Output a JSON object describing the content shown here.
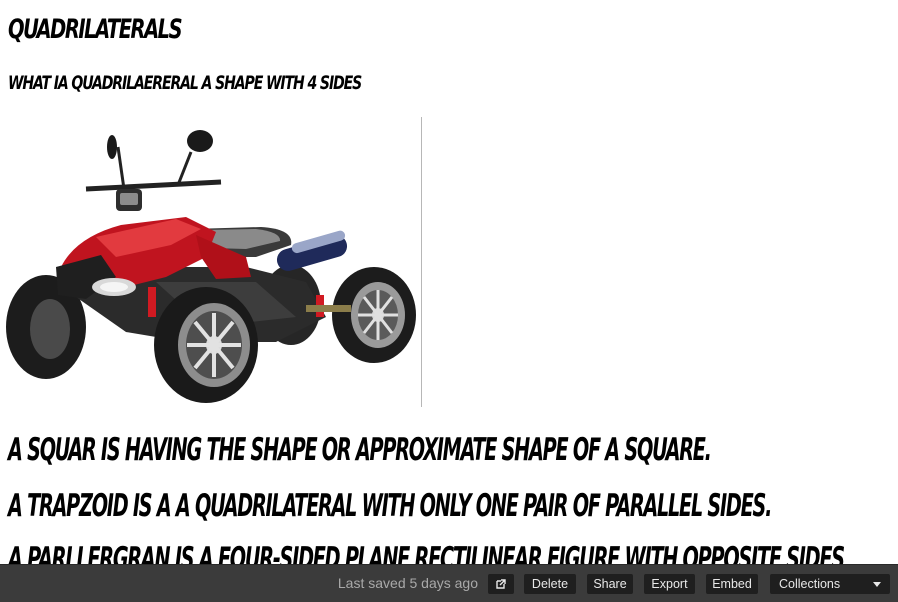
{
  "document": {
    "title": "Quadrilaterals",
    "subtitle": "what ia quadrilaereral a shape with 4 sides",
    "lines": [
      "A squar is having the shape or approximate shape of a square.",
      "A trapzoid is a a quadrilateral with only one pair of parallel sides.",
      "A parllergran is a four-sided plane rectilinear figure with opposite sides"
    ]
  },
  "toolbar": {
    "saved_status": "Last saved 5 days ago",
    "open_icon": "external-link-icon",
    "delete_label": "Delete",
    "share_label": "Share",
    "export_label": "Export",
    "embed_label": "Embed",
    "collections_label": "Collections",
    "colors": {
      "bar_background": "#3b3b3b",
      "button_background": "#1f1f1f",
      "button_text": "#e8e8e8",
      "status_text": "#a9a9a9"
    }
  }
}
